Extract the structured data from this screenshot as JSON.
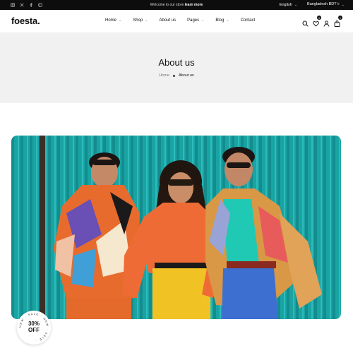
{
  "topbar": {
    "socials": [
      "instagram-icon",
      "x-icon",
      "facebook-icon",
      "pinterest-icon"
    ],
    "welcome_text": "Welcome to our store",
    "welcome_link": "learn more",
    "language": "English",
    "currency": "Bangladesh BDT ৳"
  },
  "header": {
    "logo": "foesta.",
    "nav": [
      {
        "label": "Home",
        "dropdown": true
      },
      {
        "label": "Shop",
        "dropdown": true
      },
      {
        "label": "About us",
        "dropdown": false
      },
      {
        "label": "Pages",
        "dropdown": true
      },
      {
        "label": "Blog",
        "dropdown": true
      },
      {
        "label": "Contact",
        "dropdown": false
      }
    ],
    "icons": {
      "search": "search-icon",
      "wishlist": "heart-icon",
      "account": "user-icon",
      "cart": "bag-icon"
    },
    "wishlist_count": "0",
    "cart_count": "1"
  },
  "hero": {
    "title": "About us",
    "breadcrumb_home": "Home",
    "breadcrumb_current": "About us"
  },
  "photo": {
    "icon": "fashion-photo"
  },
  "promo": {
    "value_line1": "30%",
    "value_line2": "OFF",
    "ring_text": "NEW · SALE · NEW · SALE ·"
  },
  "colors": {
    "accent": "#111111",
    "hero_bg": "#f1f1f1",
    "topbar_bg": "#0d0d0d",
    "teal": "#1aa3a3"
  }
}
